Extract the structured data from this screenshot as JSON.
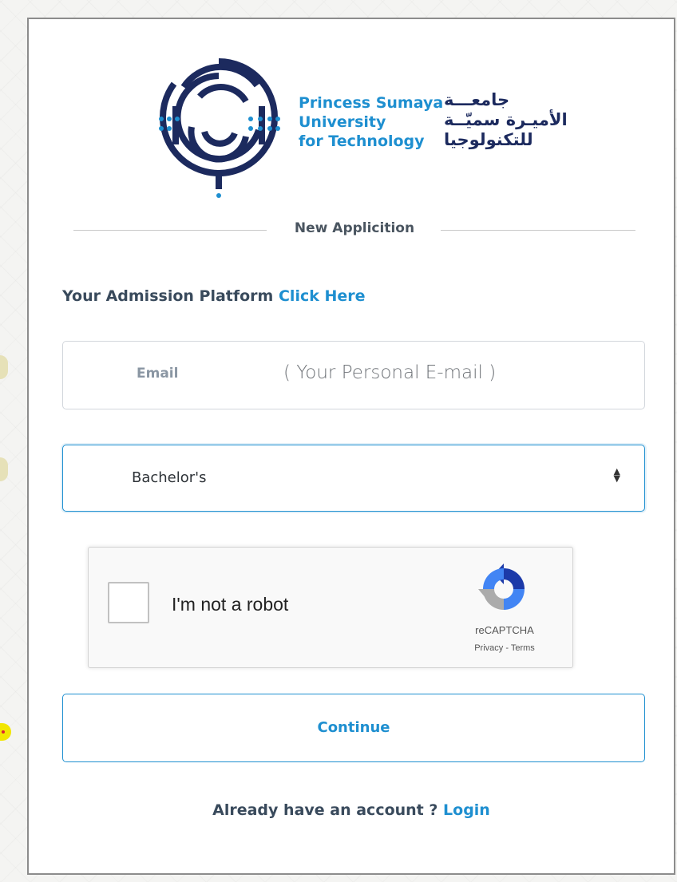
{
  "logo": {
    "icon": "psut-logo-mark",
    "english_lines": [
      "Princess Sumaya",
      "University",
      "for Technology"
    ],
    "arabic_lines": [
      "جامعـــة",
      "الأميـرة سميّــة",
      "للتكنولوجيا"
    ]
  },
  "section": {
    "divider_label": "New Applicition"
  },
  "admission": {
    "prefix": "Your Admission Platform",
    "link_label": "Click Here"
  },
  "email": {
    "label": "Email",
    "hint": "( Your Personal E-mail )"
  },
  "degree_select": {
    "selected": "Bachelor's",
    "icon": "sort-arrows-icon"
  },
  "recaptcha": {
    "checkbox_label": "I'm not a robot",
    "brand": "reCAPTCHA",
    "privacy": "Privacy",
    "separator": " - ",
    "terms": "Terms",
    "checked": false
  },
  "actions": {
    "continue_label": "Continue"
  },
  "login": {
    "prompt": "Already have an account ?",
    "link_label": "Login"
  },
  "colors": {
    "accent": "#1e8fd0",
    "navy": "#1c2a5e",
    "text": "#394a5c"
  }
}
